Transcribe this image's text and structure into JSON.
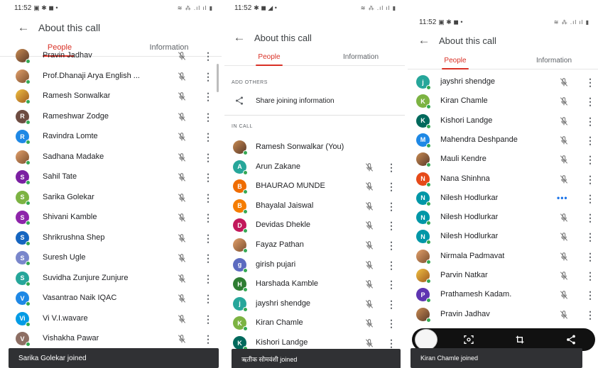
{
  "screens": [
    {
      "status_time": "11:52",
      "title": "About this call",
      "tabs": [
        "People",
        "Information"
      ],
      "participants": [
        {
          "name": "Pravin Jadhav",
          "initial": "",
          "color": "#6a8fd0",
          "photo": true
        },
        {
          "name": "Prof.Dhanaji Arya English ...",
          "initial": "",
          "color": "#e8a030",
          "photo": true
        },
        {
          "name": "Ramesh Sonwalkar",
          "initial": "",
          "color": "#4a73d0",
          "photo": true
        },
        {
          "name": "Rameshwar Zodge",
          "initial": "R",
          "color": "#6d4c41"
        },
        {
          "name": "Ravindra Lomte",
          "initial": "R",
          "color": "#1e88e5"
        },
        {
          "name": "Sadhana Madake",
          "initial": "",
          "color": "#b57d55",
          "photo": true
        },
        {
          "name": "Sahil Tate",
          "initial": "S",
          "color": "#7b1fa2"
        },
        {
          "name": "Sarika Golekar",
          "initial": "S",
          "color": "#7cb342"
        },
        {
          "name": "Shivani Kamble",
          "initial": "S",
          "color": "#8e24aa"
        },
        {
          "name": "Shrikrushna Shep",
          "initial": "S",
          "color": "#1565c0"
        },
        {
          "name": "Suresh Ugle",
          "initial": "S",
          "color": "#7986cb"
        },
        {
          "name": "Suvidha Zunjure Zunjure",
          "initial": "S",
          "color": "#26a69a"
        },
        {
          "name": "Vasantrao Naik IQAC",
          "initial": "V",
          "color": "#1e88e5"
        },
        {
          "name": "Vi V.I.wavare",
          "initial": "Vi",
          "color": "#039be5"
        },
        {
          "name": "Vishakha Pawar",
          "initial": "V",
          "color": "#8d6e63"
        }
      ],
      "snackbar": "Sarika Golekar joined"
    },
    {
      "status_time": "11:52",
      "title": "About this call",
      "tabs": [
        "People",
        "Information"
      ],
      "add_others_label": "ADD OTHERS",
      "share_label": "Share joining information",
      "in_call_label": "IN CALL",
      "participants": [
        {
          "name": "Ramesh Sonwalkar (You)",
          "initial": "",
          "color": "#4a73d0",
          "photo": true,
          "self": true
        },
        {
          "name": "Arun Zakane",
          "initial": "A",
          "color": "#26a69a"
        },
        {
          "name": "BHAURAO MUNDE",
          "initial": "B",
          "color": "#ef6c00"
        },
        {
          "name": "Bhayalal Jaiswal",
          "initial": "B",
          "color": "#f57c00"
        },
        {
          "name": "Devidas Dhekle",
          "initial": "D",
          "color": "#c2185b"
        },
        {
          "name": "Fayaz Pathan",
          "initial": "",
          "color": "#5d4037",
          "photo": true
        },
        {
          "name": "girish pujari",
          "initial": "g",
          "color": "#5c6bc0"
        },
        {
          "name": "Harshada Kamble",
          "initial": "H",
          "color": "#2e7d32"
        },
        {
          "name": "jayshri shendge",
          "initial": "j",
          "color": "#26a69a"
        },
        {
          "name": "Kiran Chamle",
          "initial": "K",
          "color": "#7cb342"
        },
        {
          "name": "Kishori Landge",
          "initial": "K",
          "color": "#00695c"
        }
      ],
      "snackbar": "ऋतीक सोमवंशी joined"
    },
    {
      "status_time": "11:52",
      "title": "About this call",
      "tabs": [
        "People",
        "Information"
      ],
      "participants": [
        {
          "name": "jayshri shendge",
          "initial": "j",
          "color": "#26a69a"
        },
        {
          "name": "Kiran Chamle",
          "initial": "K",
          "color": "#7cb342"
        },
        {
          "name": "Kishori Landge",
          "initial": "K",
          "color": "#00695c"
        },
        {
          "name": "Mahendra Deshpande",
          "initial": "M",
          "color": "#1e88e5"
        },
        {
          "name": "Mauli Kendre",
          "initial": "",
          "color": "#6d4c41",
          "photo": true
        },
        {
          "name": "Nana Shinhna",
          "initial": "N",
          "color": "#e64a19"
        },
        {
          "name": "Nilesh Hodlurkar",
          "initial": "N",
          "color": "#0097a7",
          "talking": true
        },
        {
          "name": "Nilesh Hodlurkar",
          "initial": "N",
          "color": "#0097a7"
        },
        {
          "name": "Nilesh Hodlurkar",
          "initial": "N",
          "color": "#0097a7"
        },
        {
          "name": "Nirmala Padmavat",
          "initial": "",
          "color": "#b57d55",
          "photo": true
        },
        {
          "name": "Parvin Natkar",
          "initial": "",
          "color": "#8d6e63",
          "photo": true
        },
        {
          "name": "Prathamesh Kadam.",
          "initial": "P",
          "color": "#5e35b1"
        },
        {
          "name": "Pravin Jadhav",
          "initial": "",
          "color": "#6a8fd0",
          "photo": true
        }
      ],
      "snackbar": "Kiran Chamle joined"
    }
  ],
  "icons": {
    "back": "arrow-left-icon",
    "mic_off": "mic-off-icon",
    "more": "more-vert-icon",
    "share": "share-icon",
    "talking": "speaking-dots-icon"
  },
  "colors": {
    "accent": "#d93025",
    "online": "#34a853",
    "snackbar": "#303134"
  }
}
